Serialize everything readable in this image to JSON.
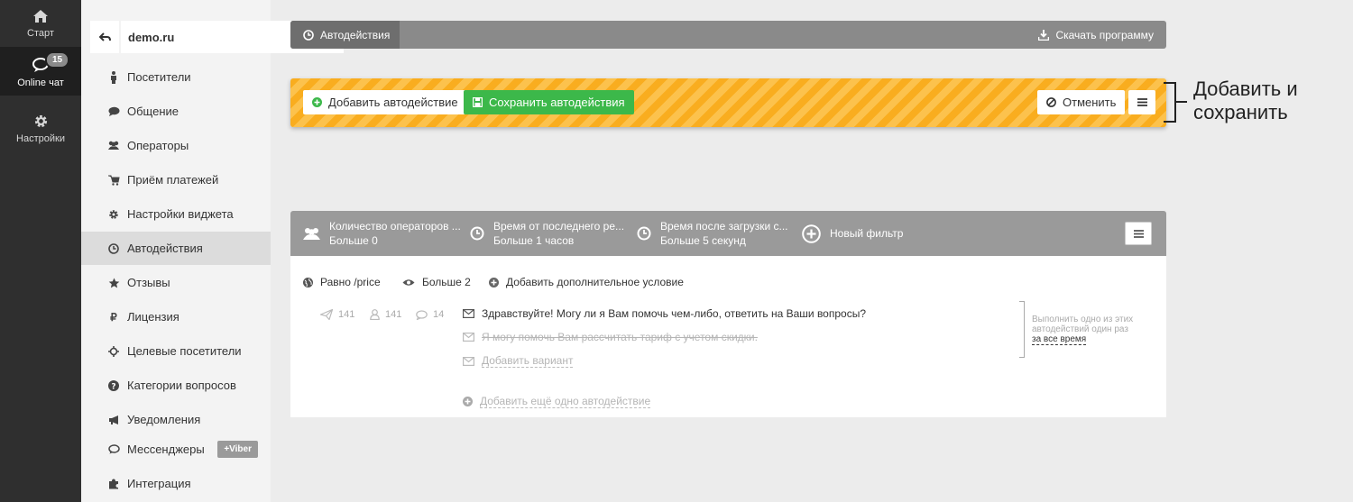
{
  "rail": {
    "start_label": "Старт",
    "chat_label": "Online чат",
    "chat_badge": "15",
    "settings_label": "Настройки"
  },
  "sidebar": {
    "site": "demo.ru",
    "items": [
      {
        "label": "Посетители",
        "icon": "male-icon"
      },
      {
        "label": "Общение",
        "icon": "comment-icon"
      },
      {
        "label": "Операторы",
        "icon": "users-icon"
      },
      {
        "label": "Приём платежей",
        "icon": "cart-icon"
      },
      {
        "label": "Настройки виджета",
        "icon": "gear-icon"
      },
      {
        "label": "Автодействия",
        "icon": "clock-icon"
      },
      {
        "label": "Отзывы",
        "icon": "star-icon"
      },
      {
        "label": "Лицензия",
        "icon": "ruble-icon"
      },
      {
        "label": "Целевые посетители",
        "icon": "crosshair-icon"
      },
      {
        "label": "Категории вопросов",
        "icon": "question-icon"
      },
      {
        "label": "Уведомления",
        "icon": "megaphone-icon"
      },
      {
        "label": "Мессенджеры",
        "icon": "chat-bubbles-icon",
        "badge": "+Viber"
      },
      {
        "label": "Интеграция",
        "icon": "puzzle-icon"
      }
    ]
  },
  "topbar": {
    "tab": "Автодействия",
    "download": "Скачать программу"
  },
  "actionbar": {
    "add": "Добавить автодействие",
    "save": "Сохранить автодействия",
    "cancel": "Отменить"
  },
  "annotation": {
    "line1": "Добавить и",
    "line2": "сохранить"
  },
  "filters": [
    {
      "title": "Количество операторов ...",
      "value": "Больше 0"
    },
    {
      "title": "Время от последнего ре...",
      "value": "Больше 1 часов"
    },
    {
      "title": "Время после загрузки с...",
      "value": "Больше 5 секунд"
    },
    {
      "title": "Новый фильтр",
      "value": ""
    }
  ],
  "conditions": {
    "page": "Равно /price",
    "views": "Больше 2",
    "add": "Добавить дополнительное условие"
  },
  "stats": {
    "sent": "141",
    "users": "141",
    "replies": "14"
  },
  "messages": {
    "primary": "Здравствуйте! Могу ли я Вам помочь чем-либо, ответить на Ваши вопросы?",
    "secondary": "Я могу помочь Вам рассчитать тариф с учетом скидки.",
    "add_variant": "Добавить вариант",
    "add_action": "Добавить ещё одно автодействие"
  },
  "side_note": {
    "text": "Выполнить одно из этих автодействий один раз",
    "link": "за все время"
  },
  "colors": {
    "rail_bg": "#2f2f2f",
    "accent_orange": "#f9ad1f",
    "green": "#3cb84a"
  }
}
